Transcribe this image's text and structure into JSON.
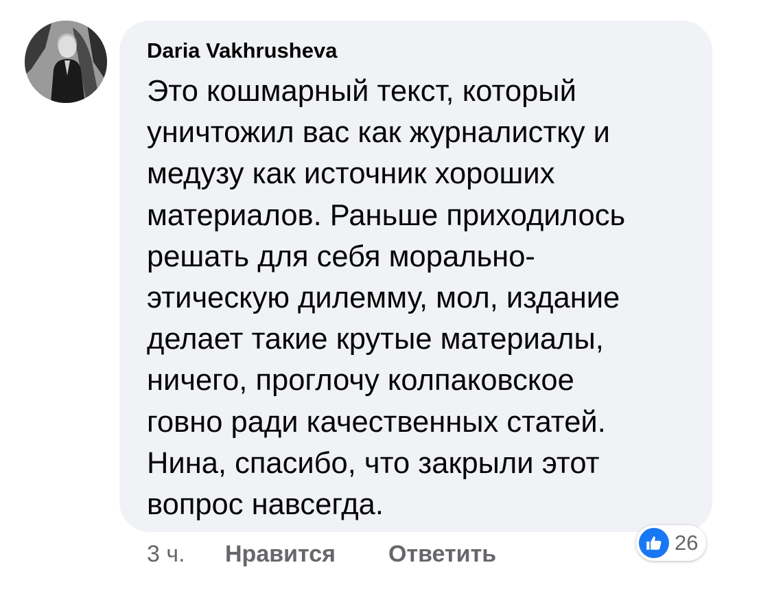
{
  "comment": {
    "author": "Daria Vakhrusheva",
    "lines": [
      "Это кошмарный текст, который",
      "уничтожил вас как журналистку и",
      "медузу как источник хороших",
      "материалов. Раньше приходилось",
      "решать для себя морально-",
      "этическую дилемму, мол, издание",
      "делает такие крутые материалы,",
      "ничего, проглочу колпаковское",
      "говно ради качественных статей.",
      "Нина, спасибо, что закрыли этот",
      "вопрос навсегда."
    ]
  },
  "actions": {
    "time": "3 ч.",
    "like_label": "Нравится",
    "reply_label": "Ответить"
  },
  "reactions": {
    "icon": "thumbs-up-icon",
    "count": "26"
  },
  "colors": {
    "bubble": "#f0f2f5",
    "text": "#050505",
    "muted": "#65676b",
    "like_blue": "#1877f2"
  }
}
